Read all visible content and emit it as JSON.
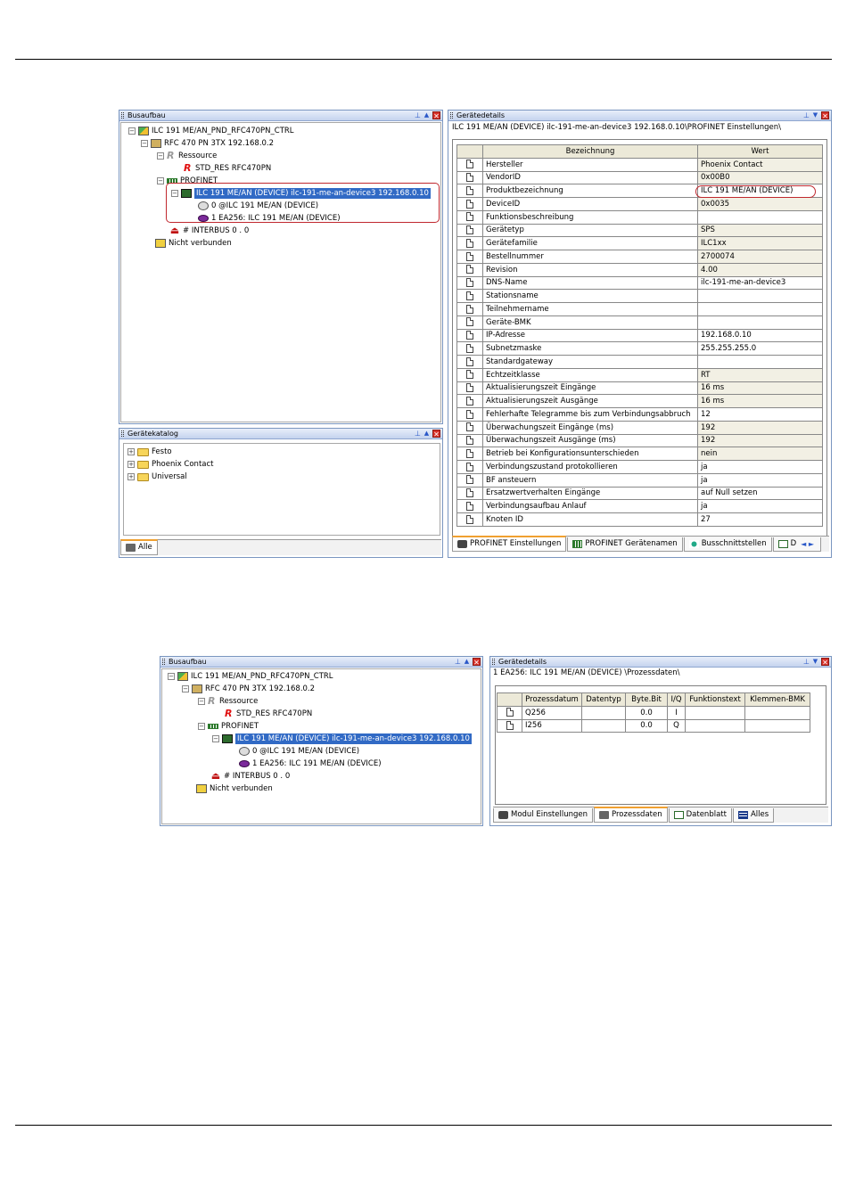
{
  "panels": {
    "busaufbau_title": "Busaufbau",
    "geraetekatalog_title": "Gerätekatalog",
    "geraetedetails_title": "Gerätedetails"
  },
  "window_buttons": {
    "pin": "⊥",
    "up": "▲",
    "down": "▼",
    "close": "✕"
  },
  "tree1": {
    "root": "ILC 191 ME/AN_PND_RFC470PN_CTRL",
    "rfc": "RFC 470 PN 3TX 192.168.0.2",
    "ressource": "Ressource",
    "std_res": "STD_RES RFC470PN",
    "profinet": "PROFINET",
    "device": "ILC 191 ME/AN (DEVICE) ilc-191-me-an-device3 192.168.0.10",
    "mod0": "0 @ILC 191 ME/AN (DEVICE)",
    "mod1": "1 EA256: ILC 191 ME/AN (DEVICE)",
    "interbus": "# INTERBUS 0 . 0",
    "nicht": "Nicht verbunden"
  },
  "catalog": {
    "items": [
      "Festo",
      "Phoenix Contact",
      "Universal"
    ],
    "tab": "Alle"
  },
  "details1": {
    "path": "ILC 191 ME/AN (DEVICE) ilc-191-me-an-device3 192.168.0.10\\PROFINET Einstellungen\\",
    "col_name": "Bezeichnung",
    "col_value": "Wert",
    "rows": [
      {
        "name": "Hersteller",
        "value": "Phoenix Contact"
      },
      {
        "name": "VendorID",
        "value": "0x00B0"
      },
      {
        "name": "Produktbezeichnung",
        "value": "ILC 191 ME/AN (DEVICE)"
      },
      {
        "name": "DeviceID",
        "value": "0x0035"
      },
      {
        "name": "Funktionsbeschreibung",
        "value": ""
      },
      {
        "name": "Gerätetyp",
        "value": "SPS"
      },
      {
        "name": "Gerätefamilie",
        "value": "ILC1xx"
      },
      {
        "name": "Bestellnummer",
        "value": "2700074"
      },
      {
        "name": "Revision",
        "value": "4.00"
      },
      {
        "name": "DNS-Name",
        "value": "ilc-191-me-an-device3"
      },
      {
        "name": "Stationsname",
        "value": ""
      },
      {
        "name": "Teilnehmername",
        "value": ""
      },
      {
        "name": "Geräte-BMK",
        "value": ""
      },
      {
        "name": "IP-Adresse",
        "value": "192.168.0.10"
      },
      {
        "name": "Subnetzmaske",
        "value": "255.255.255.0"
      },
      {
        "name": "Standardgateway",
        "value": ""
      },
      {
        "name": "Echtzeitklasse",
        "value": "RT"
      },
      {
        "name": "Aktualisierungszeit Eingänge",
        "value": "16 ms"
      },
      {
        "name": "Aktualisierungszeit Ausgänge",
        "value": "16 ms"
      },
      {
        "name": "Fehlerhafte Telegramme bis zum Verbindungsabbruch",
        "value": "12"
      },
      {
        "name": "Überwachungszeit Eingänge (ms)",
        "value": "192"
      },
      {
        "name": "Überwachungszeit Ausgänge (ms)",
        "value": "192"
      },
      {
        "name": "Betrieb bei Konfigurationsunterschieden",
        "value": "nein"
      },
      {
        "name": "Verbindungszustand protokollieren",
        "value": "ja"
      },
      {
        "name": "BF ansteuern",
        "value": "ja"
      },
      {
        "name": "Ersatzwertverhalten Eingänge",
        "value": "auf Null setzen"
      },
      {
        "name": "Verbindungsaufbau Anlauf",
        "value": "ja"
      },
      {
        "name": "Knoten ID",
        "value": "27"
      }
    ],
    "tabs": [
      "PROFINET Einstellungen",
      "PROFINET Gerätenamen",
      "Busschnittstellen",
      "D"
    ],
    "scroll": "◄ ►"
  },
  "details2": {
    "path": "1 EA256: ILC 191 ME/AN (DEVICE) \\Prozessdaten\\",
    "headers": [
      "Prozessdatum",
      "Datentyp",
      "Byte.Bit",
      "I/Q",
      "Funktionstext",
      "Klemmen-BMK"
    ],
    "rows": [
      [
        "Q256",
        "",
        "0.0",
        "I",
        "",
        ""
      ],
      [
        "I256",
        "",
        "0.0",
        "Q",
        "",
        ""
      ]
    ],
    "tabs": [
      "Modul Einstellungen",
      "Prozessdaten",
      "Datenblatt",
      "Alles"
    ]
  }
}
